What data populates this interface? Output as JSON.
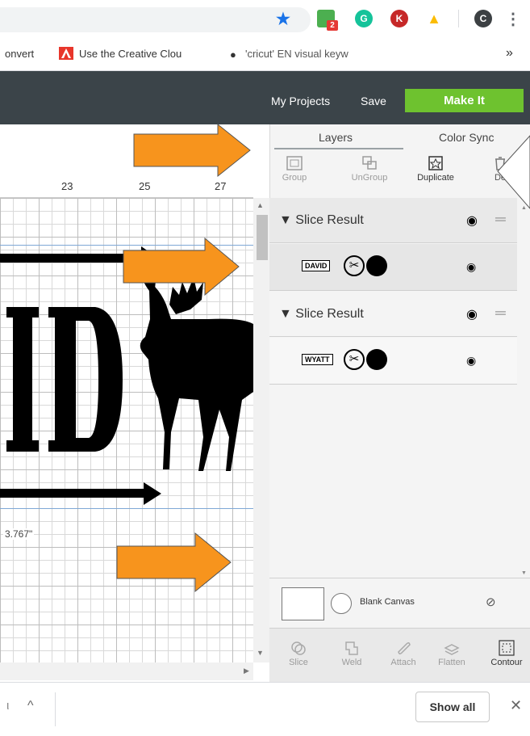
{
  "browser": {
    "extensions": [
      {
        "name": "bookmark-star-icon",
        "glyph": "★",
        "color": "#1a73e8"
      },
      {
        "name": "extension-badge-icon",
        "badge": "2",
        "color": "#4caf50"
      },
      {
        "name": "grammarly-icon",
        "glyph": "G",
        "color": "#15c39a"
      },
      {
        "name": "k-extension-icon",
        "glyph": "K",
        "color": "#c62828"
      },
      {
        "name": "google-drive-icon",
        "glyph": "▲",
        "color": "#fbbc04"
      },
      {
        "name": "profile-avatar-icon",
        "glyph": "C",
        "color": "#3c4043"
      },
      {
        "name": "menu-kebab-icon",
        "glyph": "⋮",
        "color": "#5f6368"
      }
    ],
    "bookmarks": [
      {
        "label": "onvert"
      },
      {
        "label": "Use the Creative Clou"
      },
      {
        "label": "'cricut' EN visual keyw"
      }
    ],
    "bookmarks_overflow": "»"
  },
  "header": {
    "my_projects": "My Projects",
    "save": "Save",
    "make_it": "Make It",
    "accent": "#6ec22f"
  },
  "canvas": {
    "ruler_labels": [
      "23",
      "25",
      "27"
    ],
    "dimension_label": "3.767\""
  },
  "panel": {
    "tabs": [
      "Layers",
      "Color Sync"
    ],
    "tools": [
      "Group",
      "UnGroup",
      "Duplicate",
      "De"
    ],
    "groups": [
      {
        "title": "Slice Result",
        "thumb_text": "DAVID"
      },
      {
        "title": "Slice Result",
        "thumb_text": "WYATT"
      }
    ],
    "blank_canvas": "Blank Canvas",
    "bottom_tools": [
      "Slice",
      "Weld",
      "Attach",
      "Flatten",
      "Contour"
    ]
  },
  "downloads": {
    "show_all": "Show all",
    "close": "✕",
    "expand": "^"
  }
}
